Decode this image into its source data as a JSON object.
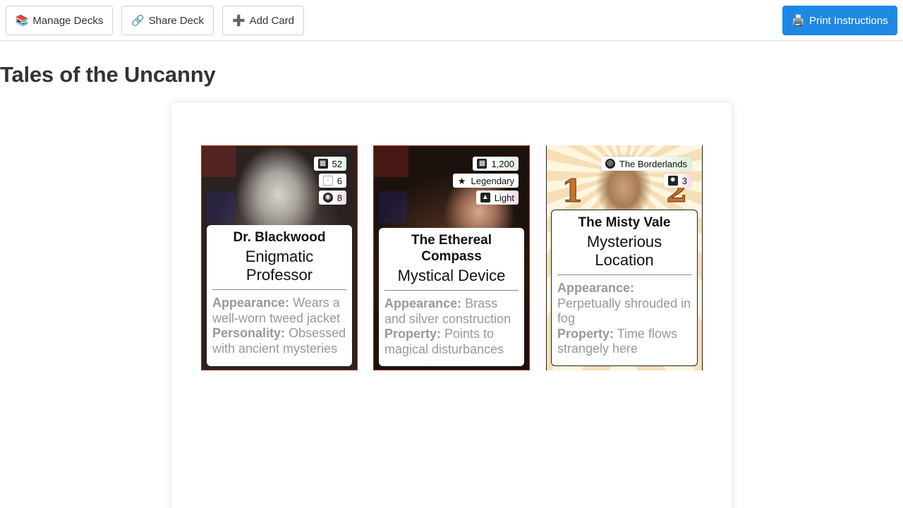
{
  "toolbar": {
    "manage_decks": "Manage Decks",
    "manage_icon": "📚",
    "share_deck": "Share Deck",
    "share_icon": "🔗",
    "add_card": "Add Card",
    "add_icon": "➕",
    "print_instructions": "Print Instructions",
    "print_icon": "🖨️",
    "print_color": "#1e88e5"
  },
  "deck": {
    "title": "Tales of the Uncanny"
  },
  "cards": [
    {
      "name": "Dr. Blackwood",
      "type": "Enigmatic Professor",
      "badges": [
        {
          "icon": "film-icon",
          "value": "52"
        },
        {
          "icon": "broken-image-icon",
          "value": "6"
        },
        {
          "icon": "brain-icon",
          "value": "8"
        }
      ],
      "field1_label": "Appearance:",
      "field1_value": "Wears a well-worn tweed jacket",
      "field2_label": "Personality:",
      "field2_value": "Obsessed with ancient mysteries"
    },
    {
      "name": "The Ethereal Compass",
      "type": "Mystical Device",
      "badges": [
        {
          "icon": "coins-icon",
          "value": "1,200"
        },
        {
          "icon": "star-icon",
          "value": "Legendary"
        },
        {
          "icon": "weight-icon",
          "value": "Light"
        }
      ],
      "field1_label": "Appearance:",
      "field1_value": "Brass and silver construction",
      "field2_label": "Property:",
      "field2_value": "Points to magical disturbances"
    },
    {
      "name": "The Misty Vale",
      "type": "Mysterious Location",
      "badges": [
        {
          "icon": "compass-icon",
          "value": "The Borderlands"
        },
        {
          "icon": "danger-icon",
          "value": "3"
        }
      ],
      "corner_numbers": [
        "1",
        "2"
      ],
      "field1_label": "Appearance:",
      "field1_value": "Perpetually shrouded in fog",
      "field2_label": "Property:",
      "field2_value": "Time flows strangely here"
    }
  ]
}
